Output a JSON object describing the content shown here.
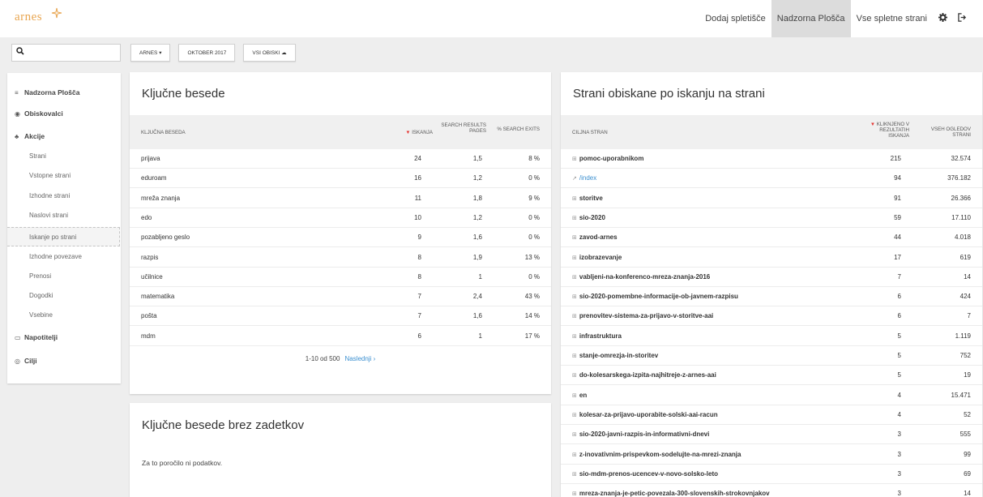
{
  "header": {
    "logo_text": "arnes",
    "nav": [
      "Dodaj spletišče",
      "Nadzorna Plošča",
      "Vse spletne strani"
    ],
    "active_nav": 1
  },
  "search": {
    "value": "",
    "placeholder": ""
  },
  "filters": [
    "ARNES ▾",
    "OKTOBER 2017",
    "VSI OBISKI ☁"
  ],
  "sidebar": {
    "items": [
      {
        "label": "Nadzorna Plošča",
        "type": "main",
        "icon": "≡"
      },
      {
        "label": "Obiskovalci",
        "type": "main",
        "icon": "👁"
      },
      {
        "label": "Akcije",
        "type": "main",
        "icon": "⚘"
      },
      {
        "label": "Strani",
        "type": "sub"
      },
      {
        "label": "Vstopne strani",
        "type": "sub"
      },
      {
        "label": "Izhodne strani",
        "type": "sub"
      },
      {
        "label": "Naslovi strani",
        "type": "sub"
      },
      {
        "label": "Iskanje po strani",
        "type": "sub",
        "active": true
      },
      {
        "label": "Izhodne povezave",
        "type": "sub"
      },
      {
        "label": "Prenosi",
        "type": "sub"
      },
      {
        "label": "Dogodki",
        "type": "sub"
      },
      {
        "label": "Vsebine",
        "type": "sub"
      },
      {
        "label": "Napotitelji",
        "type": "main",
        "icon": "▭"
      },
      {
        "label": "Cilji",
        "type": "main",
        "icon": "◎"
      }
    ]
  },
  "keywords": {
    "title": "Ključne besede",
    "headers": [
      "KLJUČNA BESEDA",
      "▼ ISKANJA",
      "SEARCH RESULTS PAGES",
      "% SEARCH EXITS"
    ],
    "rows": [
      [
        "prijava",
        "24",
        "1,5",
        "8 %"
      ],
      [
        "eduroam",
        "16",
        "1,2",
        "0 %"
      ],
      [
        "mreža znanja",
        "11",
        "1,8",
        "9 %"
      ],
      [
        "edo",
        "10",
        "1,2",
        "0 %"
      ],
      [
        "pozabljeno geslo",
        "9",
        "1,6",
        "0 %"
      ],
      [
        "razpis",
        "8",
        "1,9",
        "13 %"
      ],
      [
        "učilnice",
        "8",
        "1",
        "0 %"
      ],
      [
        "matematika",
        "7",
        "2,4",
        "43 %"
      ],
      [
        "pošta",
        "7",
        "1,6",
        "14 %"
      ],
      [
        "mdm",
        "6",
        "1",
        "17 %"
      ]
    ],
    "pager_text": "1-10 od 500",
    "pager_next": "Naslednji ›"
  },
  "no_results": {
    "title": "Ključne besede brez zadetkov",
    "message": "Za to poročilo ni podatkov."
  },
  "pages": {
    "title": "Strani obiskane po iskanju na strani",
    "headers": [
      "CILJNA STRAN",
      "▼ KLIKNJENO V REZULTATIH ISKANJA",
      "VSEH OGLEDOV STRANI"
    ],
    "rows": [
      [
        "pomoc-uporabnikom",
        "215",
        "32.574"
      ],
      [
        "/index",
        "94",
        "376.182"
      ],
      [
        "storitve",
        "91",
        "26.366"
      ],
      [
        "sio-2020",
        "59",
        "17.110"
      ],
      [
        "zavod-arnes",
        "44",
        "4.018"
      ],
      [
        "izobrazevanje",
        "17",
        "619"
      ],
      [
        "vabljeni-na-konferenco-mreza-znanja-2016",
        "7",
        "14"
      ],
      [
        "sio-2020-pomembne-informacije-ob-javnem-razpisu",
        "6",
        "424"
      ],
      [
        "prenovitev-sistema-za-prijavo-v-storitve-aai",
        "6",
        "7"
      ],
      [
        "infrastruktura",
        "5",
        "1.119"
      ],
      [
        "stanje-omrezja-in-storitev",
        "5",
        "752"
      ],
      [
        "do-kolesarskega-izpita-najhitreje-z-arnes-aai",
        "5",
        "19"
      ],
      [
        "en",
        "4",
        "15.471"
      ],
      [
        "kolesar-za-prijavo-uporabite-solski-aai-racun",
        "4",
        "52"
      ],
      [
        "sio-2020-javni-razpis-in-informativni-dnevi",
        "3",
        "555"
      ],
      [
        "z-inovativnim-prispevkom-sodelujte-na-mrezi-znanja",
        "3",
        "99"
      ],
      [
        "sio-mdm-prenos-ucencev-v-novo-solsko-leto",
        "3",
        "69"
      ],
      [
        "mreza-znanja-je-petic-povezala-300-slovenskih-strokovnjakov",
        "3",
        "14"
      ]
    ]
  },
  "colors": {
    "accent": "#e8a550",
    "link": "#3a8fd0",
    "sort_arrow": "#e53935"
  }
}
